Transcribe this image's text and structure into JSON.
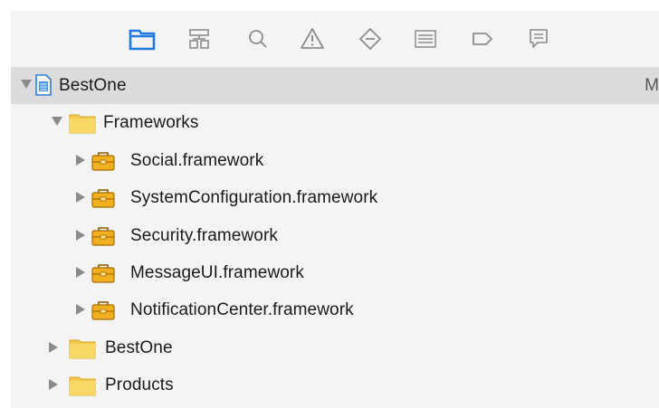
{
  "toolbar": {
    "items": [
      {
        "icon": "folder-icon",
        "active": true
      },
      {
        "icon": "hierarchy-icon"
      },
      {
        "icon": "search-icon"
      },
      {
        "icon": "warning-icon"
      },
      {
        "icon": "breakpoint-diamond-icon"
      },
      {
        "icon": "list-icon"
      },
      {
        "icon": "tag-icon"
      },
      {
        "icon": "message-icon"
      }
    ],
    "accent": "#1f7ae0",
    "icon_color": "#8c8c8c"
  },
  "tree": {
    "project": {
      "label": "BestOne",
      "trailing": "M"
    },
    "frameworks_group": {
      "label": "Frameworks"
    },
    "frameworks": [
      {
        "label": "Social.framework"
      },
      {
        "label": "SystemConfiguration.framework"
      },
      {
        "label": "Security.framework"
      },
      {
        "label": "MessageUI.framework"
      },
      {
        "label": "NotificationCenter.framework"
      }
    ],
    "groups": [
      {
        "label": "BestOne"
      },
      {
        "label": "Products"
      }
    ]
  },
  "colors": {
    "folder": "#f2c94c",
    "toolbox": "#e8a317",
    "selection": "#dcdcdc"
  }
}
